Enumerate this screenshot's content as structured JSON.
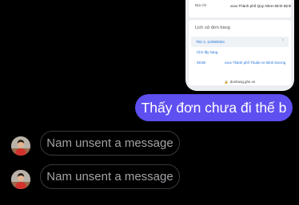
{
  "shared_image": {
    "address_label": "Địa chỉ",
    "address_value": "xxxx Thành phố Quy Nhơn Bình Định",
    "history_title": "Lịch sử đơn hàng",
    "history_date": "Thứ 4, 11/09/2024",
    "status_label": "Chờ lấy hàng",
    "event_time": "09:58",
    "event_location": "xxxx Thành phố Thuận An Bình Dương",
    "url": "donhang.ghn.vn",
    "lock_icon": "lock-icon",
    "chevron_icon": "chevron-up-icon"
  },
  "outgoing_message": {
    "text": "Thấy đơn chưa đi thế b",
    "bubble_color": "#5e4ff0"
  },
  "unsent_messages": [
    {
      "text": "Nam unsent a message"
    },
    {
      "text": "Nam unsent a message"
    }
  ]
}
